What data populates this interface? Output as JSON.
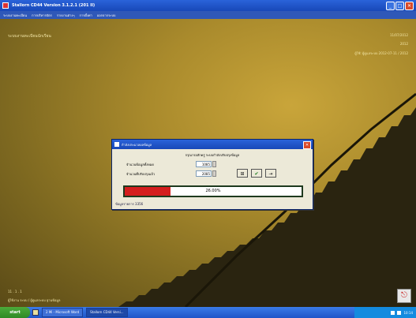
{
  "window": {
    "title": "Stallorn CD44 Version 3.1.2.1 (201 II)",
    "controls": [
      "_",
      "□",
      "✕"
    ]
  },
  "menu": {
    "items": [
      "ระบบงานทะเบียน",
      "การบริหารบัตร",
      "รายงานต่างๆ",
      "การตั้งค่า",
      "ออกจากระบบ"
    ]
  },
  "desktop": {
    "heading": "ระบบงานทะเบียนนักเรียน",
    "info_line_1": "11/07/2012",
    "info_line_2": "2012",
    "info_line_3": "ผู้ใช้: ผู้ดูแลระบบ 2012-07-11 / 2012",
    "bottom_text_1": "11 . 1 . 1",
    "bottom_text_2": "ผู้ใช้งาน ระบบ / ผู้ดูแลระบบ ฐานข้อมูล",
    "corner_icon": "exit-icon"
  },
  "dialog": {
    "title": "กำลังประมวลผลข้อมูล",
    "subtitle": "กรุณารอสักครู่ ระบบกำลังปรับปรุงข้อมูล",
    "label_first": "จำนวนข้อมูลทั้งหมด",
    "value_first": "1085",
    "label_second": "จำนวนที่ปรับปรุงแล้ว",
    "value_second": "2085",
    "buttons": [
      "⊞",
      "✔",
      "⇥"
    ],
    "progress_fraction": 0.26,
    "progress_text": "26.00%",
    "footer_text": "ข้อมูลรายการ 3356"
  },
  "taskbar": {
    "start_label": "start",
    "tasks": [
      "2 Mi - Microsoft Word",
      "Stallorn CD44 Versi..."
    ],
    "clock": "10:14"
  },
  "colors": {
    "progress_fill": "#d41e1e",
    "titlebar": "#1848b8"
  }
}
